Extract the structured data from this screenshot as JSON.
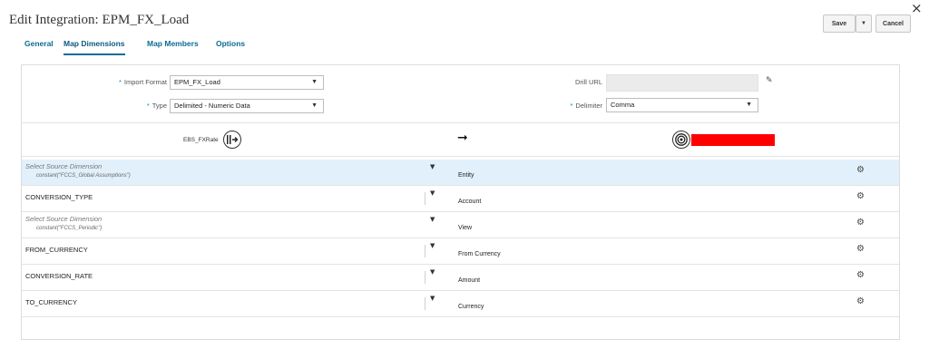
{
  "header": {
    "title": "Edit Integration: EPM_FX_Load",
    "close_glyph": "×"
  },
  "toolbar": {
    "save_label": "Save",
    "dropdown_glyph": "▼",
    "cancel_label": "Cancel"
  },
  "tabs": [
    {
      "label": "General",
      "active": false
    },
    {
      "label": "Map Dimensions",
      "active": true
    },
    {
      "label": "Map Members",
      "active": false
    },
    {
      "label": "Options",
      "active": false
    }
  ],
  "form": {
    "required_mark": "*",
    "import_format_label": "Import Format",
    "import_format_value": "EPM_FX_Load",
    "type_label": "Type",
    "type_value": "Delimited - Numeric Data",
    "drill_url_label": "Drill URL",
    "drill_url_value": "",
    "delimiter_label": "Delimiter",
    "delimiter_value": "Comma"
  },
  "mapping_header": {
    "source_name": "EBS_FXRate",
    "target_name_redacted": true,
    "redaction_color": "#ff0000"
  },
  "rows": [
    {
      "source": "Select Source Dimension",
      "placeholder": true,
      "expression": "constant(\"FCCS_Global Assumptions\")",
      "target": "Entity",
      "selected": true
    },
    {
      "source": "CONVERSION_TYPE",
      "placeholder": false,
      "expression": "",
      "target": "Account",
      "selected": false
    },
    {
      "source": "Select Source Dimension",
      "placeholder": true,
      "expression": "constant(\"FCCS_Periodic\")",
      "target": "View",
      "selected": false
    },
    {
      "source": "FROM_CURRENCY",
      "placeholder": false,
      "expression": "",
      "target": "From Currency",
      "selected": false
    },
    {
      "source": "CONVERSION_RATE",
      "placeholder": false,
      "expression": "",
      "target": "Amount",
      "selected": false
    },
    {
      "source": "TO_CURRENCY",
      "placeholder": false,
      "expression": "",
      "target": "Currency",
      "selected": false
    }
  ],
  "icons": {
    "caret": "▼",
    "gear": "⚙",
    "pencil": "✎",
    "arrow": "➞",
    "source_icon": "source-connector-icon",
    "target_icon": "target-icon"
  },
  "colors": {
    "accent": "#0c6b93",
    "selected_row": "#e1f0fb",
    "required": "#1d83c6"
  }
}
